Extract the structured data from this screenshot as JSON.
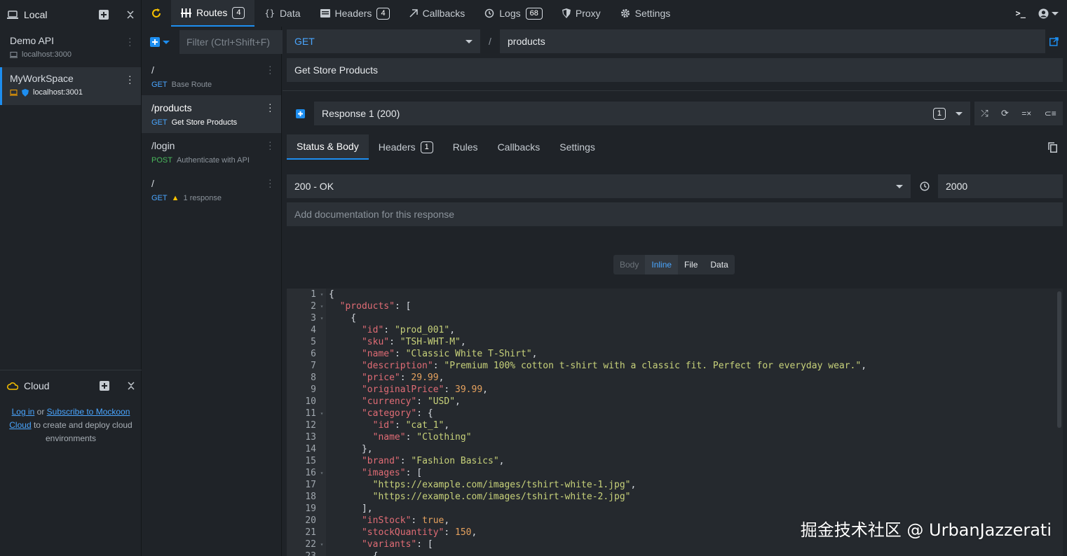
{
  "environments": {
    "header": {
      "title": "Local"
    },
    "items": [
      {
        "name": "Demo API",
        "host": "localhost:3000"
      },
      {
        "name": "MyWorkSpace",
        "host": "localhost:3001"
      }
    ],
    "cloud": {
      "title": "Cloud",
      "login_link": "Log in",
      "or_text": "or",
      "subscribe_link": "Subscribe to Mockoon",
      "cloud_link": "Cloud",
      "rest_text": "to create and deploy cloud environments"
    }
  },
  "top_tabs": [
    {
      "label": "Routes",
      "badge": "4"
    },
    {
      "label": "Data",
      "badge": ""
    },
    {
      "label": "Headers",
      "badge": "4"
    },
    {
      "label": "Callbacks",
      "badge": ""
    },
    {
      "label": "Logs",
      "badge": "68"
    },
    {
      "label": "Proxy",
      "badge": ""
    },
    {
      "label": "Settings",
      "badge": ""
    }
  ],
  "routes": {
    "filter_placeholder": "Filter (Ctrl+Shift+F)",
    "items": [
      {
        "path": "/",
        "method": "GET",
        "description": "Base Route"
      },
      {
        "path": "/products",
        "method": "GET",
        "description": "Get Store Products"
      },
      {
        "path": "/login",
        "method": "POST",
        "description": "Authenticate with API"
      },
      {
        "path": "/",
        "method": "GET",
        "description": "1 response"
      }
    ]
  },
  "route_editor": {
    "method": "GET",
    "path_prefix": "/",
    "path": "products",
    "documentation": "Get Store Products",
    "response_label": "Response 1 (200)",
    "response_count": "1",
    "subtabs": [
      {
        "label": "Status & Body",
        "badge": ""
      },
      {
        "label": "Headers",
        "badge": "1"
      },
      {
        "label": "Rules",
        "badge": ""
      },
      {
        "label": "Callbacks",
        "badge": ""
      },
      {
        "label": "Settings",
        "badge": ""
      }
    ],
    "status": "200 - OK",
    "latency": "2000",
    "response_doc_placeholder": "Add documentation for this response",
    "body_tabs": [
      "Body",
      "Inline",
      "File",
      "Data"
    ]
  },
  "editor_lines": [
    "{",
    "  \"products\": [",
    "    {",
    "      \"id\": \"prod_001\",",
    "      \"sku\": \"TSH-WHT-M\",",
    "      \"name\": \"Classic White T-Shirt\",",
    "      \"description\": \"Premium 100% cotton t-shirt with a classic fit. Perfect for everyday wear.\",",
    "      \"price\": 29.99,",
    "      \"originalPrice\": 39.99,",
    "      \"currency\": \"USD\",",
    "      \"category\": {",
    "        \"id\": \"cat_1\",",
    "        \"name\": \"Clothing\"",
    "      },",
    "      \"brand\": \"Fashion Basics\",",
    "      \"images\": [",
    "        \"https://example.com/images/tshirt-white-1.jpg\",",
    "        \"https://example.com/images/tshirt-white-2.jpg\"",
    "      ],",
    "      \"inStock\": true,",
    "      \"stockQuantity\": 150,",
    "      \"variants\": [",
    "        {"
  ],
  "watermark": "掘金技术社区 @ UrbanJazzerati",
  "colors": {
    "accent": "#1d8ef0",
    "get": "#4aa6ff",
    "post": "#4ab85c",
    "warning": "#f6c000"
  }
}
